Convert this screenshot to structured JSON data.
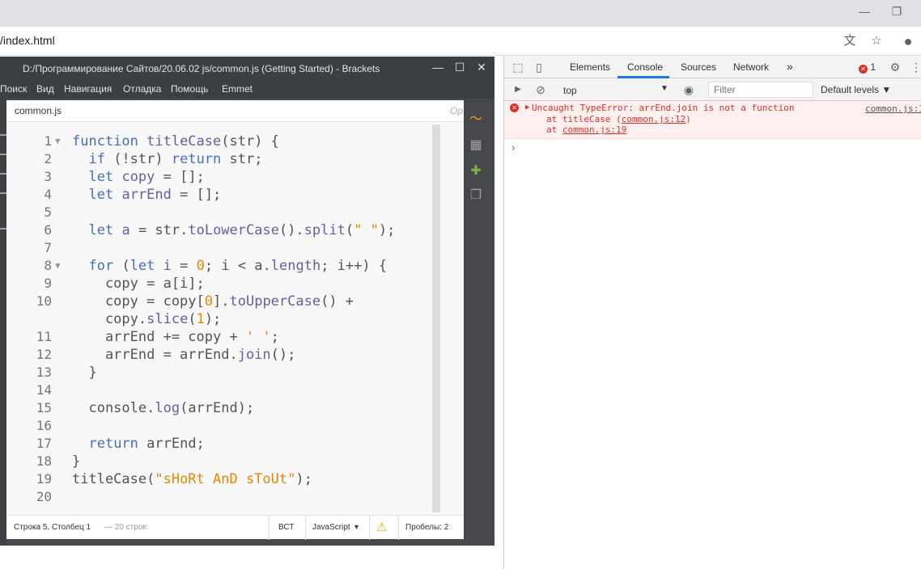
{
  "browser": {
    "url": "/index.html",
    "minimize_glyph": "—",
    "restore_glyph": "❐",
    "translate_glyph": "文",
    "star_glyph": "☆",
    "profile_glyph": "●"
  },
  "brackets": {
    "title": "D:/Программирование Сайтов/20.06.02 js/common.js (Getting Started) - Brackets",
    "window_buttons": {
      "min": "—",
      "max": "☐",
      "close": "✕"
    },
    "menu": [
      "Поиск",
      "Вид",
      "Навигация",
      "Отладка",
      "Помощь",
      "Emmet"
    ],
    "tab": {
      "filename": "common.js",
      "right_label": "Op"
    },
    "status": {
      "position": "Строка 5, Столбец 1",
      "lines": "— 20 строк",
      "mode": "ВСТ",
      "language": "JavaScript",
      "language_arrow": "▾",
      "warning": "⚠",
      "spaces": "Пробелы: 2"
    },
    "sidebar_icons": [
      "live-preview",
      "extensions",
      "gift",
      "docs"
    ],
    "sidebar_glyphs": [
      "〜",
      "▦",
      "✚",
      "❒"
    ],
    "accent_colors": {
      "keyword": "#446fbd",
      "function": "#6d5ba0",
      "literal": "#e88501"
    }
  },
  "code": {
    "fold_glyph": "▼",
    "lines": [
      {
        "n": "1",
        "fold": true,
        "tokens": [
          [
            "kw",
            "function "
          ],
          [
            "fn",
            "titleCase"
          ],
          [
            "p",
            "(str) {"
          ]
        ]
      },
      {
        "n": "2",
        "fold": false,
        "tokens": [
          [
            "p",
            "  "
          ],
          [
            "kw",
            "if"
          ],
          [
            "p",
            " (!str) "
          ],
          [
            "kw",
            "return"
          ],
          [
            "p",
            " str;"
          ]
        ]
      },
      {
        "n": "3",
        "fold": false,
        "tokens": [
          [
            "p",
            "  "
          ],
          [
            "kw",
            "let"
          ],
          [
            "p",
            " "
          ],
          [
            "fn",
            "copy"
          ],
          [
            "p",
            " = [];"
          ]
        ]
      },
      {
        "n": "4",
        "fold": false,
        "tokens": [
          [
            "p",
            "  "
          ],
          [
            "kw",
            "let"
          ],
          [
            "p",
            " "
          ],
          [
            "fn",
            "arrEnd"
          ],
          [
            "p",
            " = [];"
          ]
        ]
      },
      {
        "n": "5",
        "fold": false,
        "tokens": []
      },
      {
        "n": "6",
        "fold": false,
        "tokens": [
          [
            "p",
            "  "
          ],
          [
            "kw",
            "let"
          ],
          [
            "p",
            " "
          ],
          [
            "fn",
            "a"
          ],
          [
            "p",
            " = str."
          ],
          [
            "fn",
            "toLowerCase"
          ],
          [
            "p",
            "()."
          ],
          [
            "fn",
            "split"
          ],
          [
            "p",
            "("
          ],
          [
            "str",
            "\" \""
          ],
          [
            "p",
            ");"
          ]
        ]
      },
      {
        "n": "7",
        "fold": false,
        "tokens": []
      },
      {
        "n": "8",
        "fold": true,
        "tokens": [
          [
            "p",
            "  "
          ],
          [
            "kw",
            "for"
          ],
          [
            "p",
            " ("
          ],
          [
            "kw",
            "let"
          ],
          [
            "p",
            " "
          ],
          [
            "fn",
            "i"
          ],
          [
            "p",
            " = "
          ],
          [
            "num",
            "0"
          ],
          [
            "p",
            "; i < a."
          ],
          [
            "fn",
            "length"
          ],
          [
            "p",
            "; i++) {"
          ]
        ]
      },
      {
        "n": "9",
        "fold": false,
        "tokens": [
          [
            "p",
            "    copy = a[i];"
          ]
        ]
      },
      {
        "n": "10",
        "fold": false,
        "tokens": [
          [
            "p",
            "    copy = copy["
          ],
          [
            "num",
            "0"
          ],
          [
            "p",
            "]."
          ],
          [
            "fn",
            "toUpperCase"
          ],
          [
            "p",
            "() +"
          ]
        ]
      },
      {
        "n": "",
        "fold": false,
        "tokens": [
          [
            "p",
            "    copy."
          ],
          [
            "fn",
            "slice"
          ],
          [
            "p",
            "("
          ],
          [
            "num",
            "1"
          ],
          [
            "p",
            ");"
          ]
        ]
      },
      {
        "n": "11",
        "fold": false,
        "tokens": [
          [
            "p",
            "    arrEnd += copy + "
          ],
          [
            "str",
            "' '"
          ],
          [
            "p",
            ";"
          ]
        ]
      },
      {
        "n": "12",
        "fold": false,
        "tokens": [
          [
            "p",
            "    arrEnd = arrEnd."
          ],
          [
            "fn",
            "join"
          ],
          [
            "p",
            "();"
          ]
        ]
      },
      {
        "n": "13",
        "fold": false,
        "tokens": [
          [
            "p",
            "  }"
          ]
        ]
      },
      {
        "n": "14",
        "fold": false,
        "tokens": []
      },
      {
        "n": "15",
        "fold": false,
        "tokens": [
          [
            "p",
            "  console."
          ],
          [
            "fn",
            "log"
          ],
          [
            "p",
            "(arrEnd);"
          ]
        ]
      },
      {
        "n": "16",
        "fold": false,
        "tokens": []
      },
      {
        "n": "17",
        "fold": false,
        "tokens": [
          [
            "p",
            "  "
          ],
          [
            "kw",
            "return"
          ],
          [
            "p",
            " arrEnd;"
          ]
        ]
      },
      {
        "n": "18",
        "fold": false,
        "tokens": [
          [
            "p",
            "}"
          ]
        ]
      },
      {
        "n": "19",
        "fold": false,
        "tokens": [
          [
            "p",
            "titleCase("
          ],
          [
            "str",
            "\"sHoRt AnD sToUt\""
          ],
          [
            "p",
            ");"
          ]
        ]
      },
      {
        "n": "20",
        "fold": false,
        "tokens": []
      }
    ]
  },
  "devtools": {
    "tabs": [
      "Elements",
      "Console",
      "Sources",
      "Network"
    ],
    "active_tab": "Console",
    "more_glyph": "»",
    "error_count": "1",
    "error_glyph": "✕",
    "settings_glyph": "⚙",
    "menu_glyph": "⋮",
    "inspect_glyph": "⬚",
    "device_glyph": "▯",
    "sidebar_glyph": "▶",
    "clear_glyph": "⊘",
    "eye_glyph": "◉",
    "context": "top",
    "context_arrow": "▼",
    "filter_placeholder": "Filter",
    "levels": "Default levels ▼",
    "error": {
      "arrow": "▶",
      "message": "Uncaught TypeError: arrEnd.join is not a function",
      "trace1_prefix": "at titleCase (",
      "trace1_link": "common.js:12",
      "trace1_suffix": ")",
      "trace2_prefix": "at ",
      "trace2_link": "common.js:19",
      "source": "common.js:1"
    },
    "prompt": "›"
  }
}
